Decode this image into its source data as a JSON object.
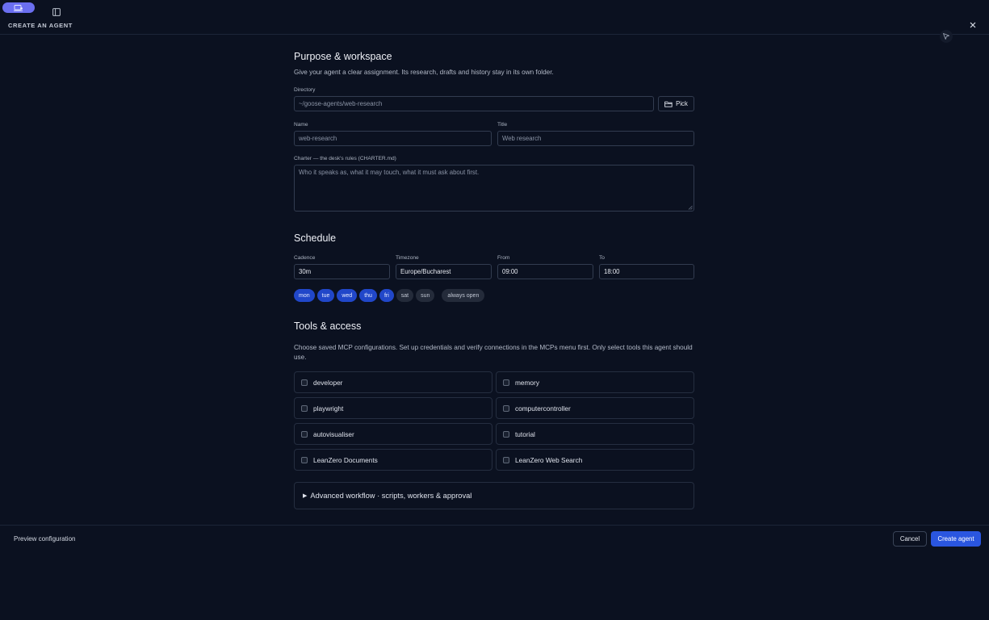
{
  "header": {
    "page_title": "CREATE AN AGENT",
    "icons": [
      "agent-pill-icon",
      "sidebar-toggle-icon",
      "close-icon",
      "cursor-icon"
    ]
  },
  "purpose": {
    "title": "Purpose & workspace",
    "description": "Give your agent a clear assignment. Its research, drafts and history stay in its own folder.",
    "directory_label": "Directory",
    "directory_value": "~/goose-agents/web-research",
    "pick_label": "Pick",
    "name_label": "Name",
    "name_placeholder": "web-research",
    "title_label": "Title",
    "title_placeholder": "Web research",
    "charter_label": "Charter — the desk's rules (CHARTER.md)",
    "charter_placeholder": "Who it speaks as, what it may touch, what it must ask about first."
  },
  "schedule": {
    "title": "Schedule",
    "cadence_label": "Cadence",
    "cadence_value": "30m",
    "timezone_label": "Timezone",
    "timezone_value": "Europe/Bucharest",
    "from_label": "From",
    "from_value": "09:00",
    "to_label": "To",
    "to_value": "18:00",
    "days": [
      {
        "label": "mon",
        "selected": true
      },
      {
        "label": "tue",
        "selected": true
      },
      {
        "label": "wed",
        "selected": true
      },
      {
        "label": "thu",
        "selected": true
      },
      {
        "label": "fri",
        "selected": true
      },
      {
        "label": "sat",
        "selected": false
      },
      {
        "label": "sun",
        "selected": false
      }
    ],
    "always_open_label": "always open"
  },
  "tools": {
    "title": "Tools & access",
    "description": "Choose saved MCP configurations. Set up credentials and verify connections in the MCPs menu first. Only select tools this agent should use.",
    "items": [
      {
        "label": "developer",
        "checked": false
      },
      {
        "label": "memory",
        "checked": false
      },
      {
        "label": "playwright",
        "checked": false
      },
      {
        "label": "computercontroller",
        "checked": false
      },
      {
        "label": "autovisualiser",
        "checked": false
      },
      {
        "label": "tutorial",
        "checked": false
      },
      {
        "label": "LeanZero Documents",
        "checked": false
      },
      {
        "label": "LeanZero Web Search",
        "checked": false
      }
    ],
    "advanced_label": "Advanced workflow · scripts, workers & approval"
  },
  "footer": {
    "preview_label": "Preview configuration",
    "cancel_label": "Cancel",
    "create_label": "Create agent"
  },
  "colors": {
    "background": "#0b1120",
    "accent": "#2a56e0",
    "day_selected": "#2147c9",
    "app_pill": "#6b6ff0"
  }
}
